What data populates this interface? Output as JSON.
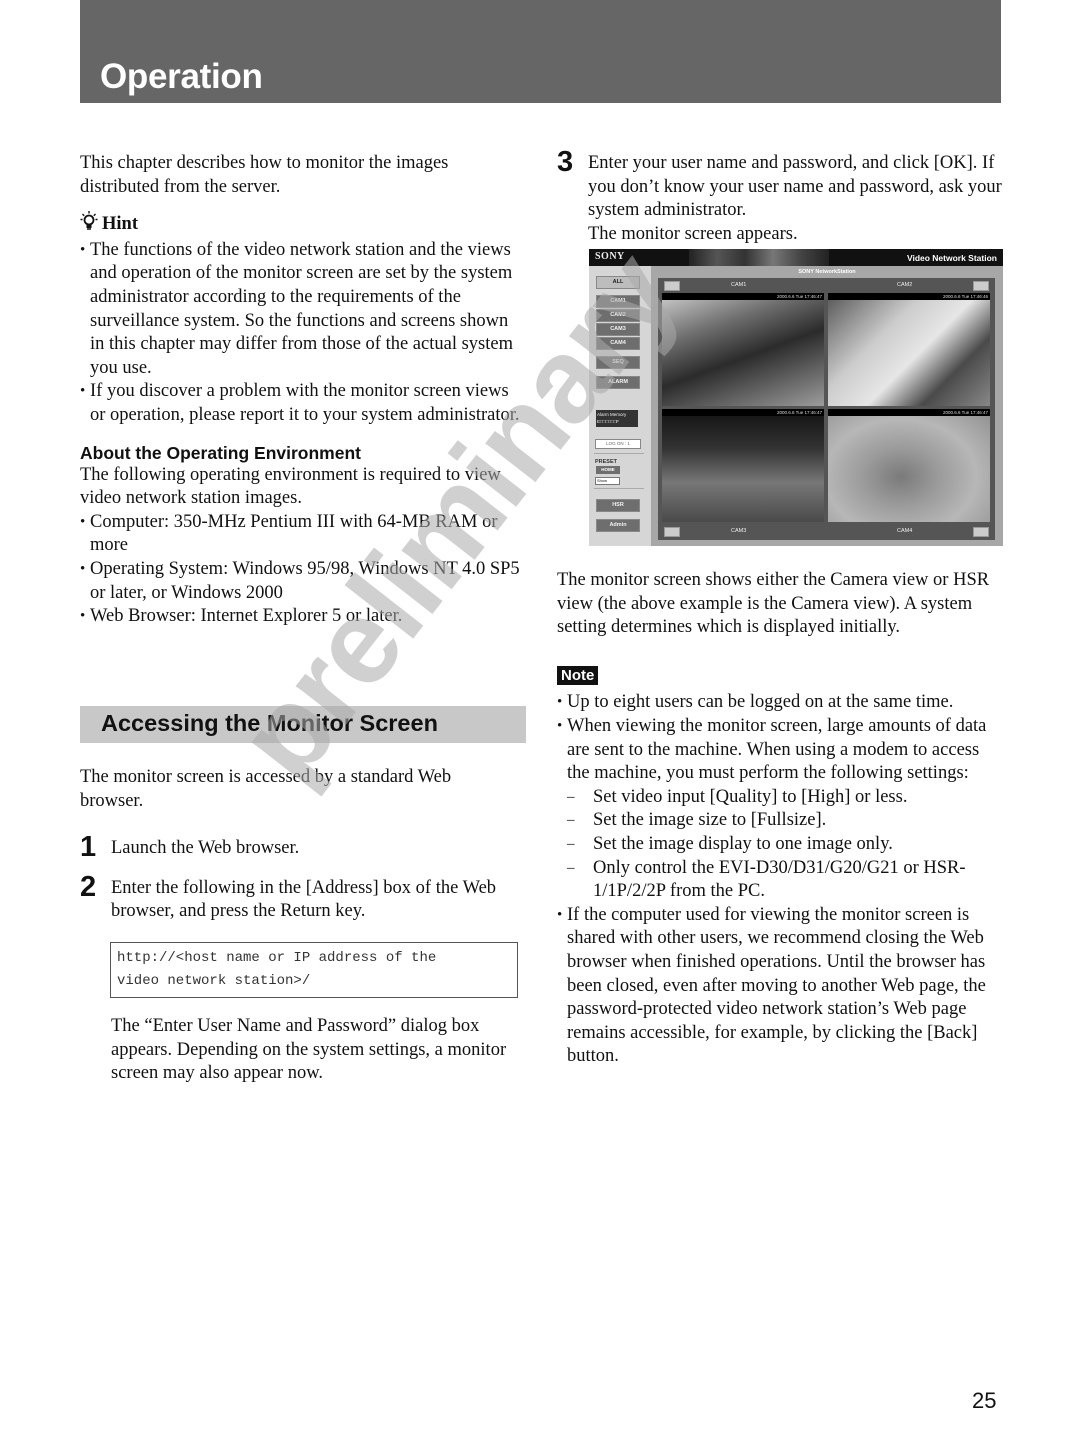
{
  "header": {
    "title": "Operation"
  },
  "left": {
    "intro": "This chapter describes how to monitor the images distributed from the server.",
    "hint": {
      "icon": "lightbulb-icon",
      "title": "Hint",
      "items": [
        "The functions of the video network station and the views and operation of the monitor screen are set by the system administrator according to the requirements of the surveillance system. So the functions and screens shown in this chapter may differ from those of the actual system you use.",
        "If you discover a problem with the monitor screen views or operation, please report it to your system administrator."
      ]
    },
    "environment": {
      "heading": "About the Operating Environment",
      "intro": "The following operating environment is required to view video network station images.",
      "items": [
        "Computer: 350-MHz Pentium III with 64-MB RAM or more",
        "Operating System: Windows 95/98, Windows NT 4.0 SP5 or later, or Windows 2000",
        "Web Browser: Internet Explorer 5 or later."
      ]
    },
    "section": {
      "heading": "Accessing the Monitor Screen",
      "intro": "The monitor screen is accessed by a standard Web browser.",
      "steps": [
        {
          "num": "1",
          "text": "Launch the Web browser."
        },
        {
          "num": "2",
          "text": "Enter the following in the [Address] box of the Web browser, and press the Return key."
        }
      ],
      "code_line1": "http://<host name or IP address of the",
      "code_line2": "video network station>/",
      "after_code": "The “Enter User Name and Password” dialog box appears. Depending on the system settings, a monitor screen may also appear now."
    }
  },
  "right": {
    "step3": {
      "num": "3",
      "text": "Enter your user name and password, and click [OK]. If you don’t know your user name and password, ask your system administrator.",
      "result": "The monitor screen appears."
    },
    "screenshot": {
      "logo": "SONY",
      "title": "Video Network Station",
      "subtitle": "SONY NetworkStation",
      "buttons": [
        "ALL",
        "CAM1",
        "CAM2",
        "CAM3",
        "CAM4",
        "SEQ",
        "ALARM"
      ],
      "alarm_memory_label": "Alarm Memory",
      "alarm_memory_value": "E□□□□□□F",
      "logon": "LOG ON : 1",
      "preset_label": "PRESET",
      "home_button": "HOME",
      "view_select": "Show",
      "bottom_buttons": [
        "HSR",
        "Admin"
      ],
      "cameras": [
        {
          "label": "CAM1",
          "timestamp": "2000.6.6 Tue 17:46:47"
        },
        {
          "label": "CAM2",
          "timestamp": "2000.6.6 Tue 17:46:46"
        },
        {
          "label": "CAM3",
          "timestamp": "2000.6.6 Tue 17:46:47"
        },
        {
          "label": "CAM4",
          "timestamp": "2000.6.6 Tue 17:46:47"
        }
      ]
    },
    "caption": "The monitor screen shows either the Camera view or HSR view (the above example is the Camera view). A system setting determines which is displayed initially.",
    "note": {
      "label": "Note",
      "items": [
        {
          "text": "Up to eight users can be logged on at the same time."
        },
        {
          "text": "When viewing the monitor screen, large amounts of data are sent to the machine. When using a modem to access the machine, you must perform the following settings:",
          "sub": [
            "Set video input [Quality] to [High] or less.",
            "Set the image size to [Fullsize].",
            "Set the image display to one image only.",
            "Only control the EVI-D30/D31/G20/G21 or HSR-1/1P/2/2P from the PC."
          ]
        },
        {
          "text": "If the computer used for viewing the monitor screen is shared with other users, we recommend closing the Web browser when finished operations. Until the browser has been closed, even after moving to another Web page, the password-protected video network station’s Web page remains accessible, for example, by clicking the [Back] button."
        }
      ]
    }
  },
  "watermark": "preliminary",
  "page_number": "25"
}
